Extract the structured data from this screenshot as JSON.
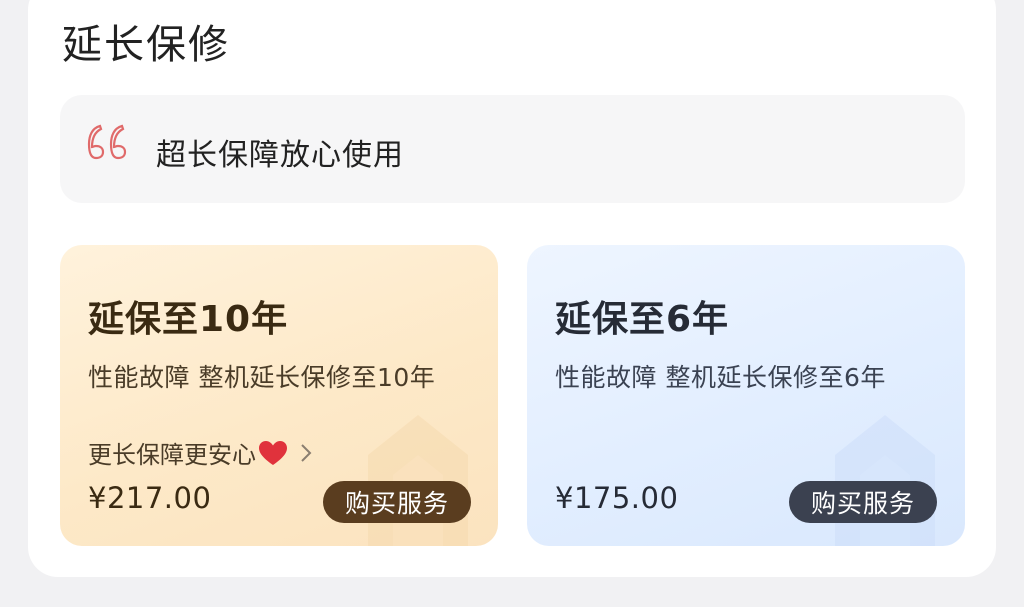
{
  "section": {
    "title": "延长保修"
  },
  "slogan": {
    "icon": "quote-icon",
    "text": "超长保障放心使用"
  },
  "plans": [
    {
      "title": "延保至10年",
      "description": "性能故障 整机延长保修至10年",
      "note": "更长保障更安心",
      "note_icon": "heart-icon",
      "price": "¥217.00",
      "button_label": "购买服务",
      "accent": "#5a3d1f"
    },
    {
      "title": "延保至6年",
      "description": "性能故障 整机延长保修至6年",
      "price": "¥175.00",
      "button_label": "购买服务",
      "accent": "#3b4150"
    }
  ]
}
